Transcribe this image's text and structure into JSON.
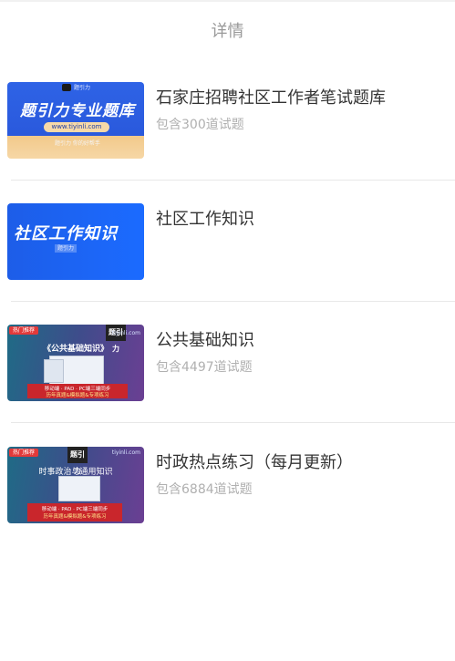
{
  "header": {
    "title": "详情"
  },
  "items": [
    {
      "title": "石家庄招聘社区工作者笔试题库",
      "subtitle": "包含300道试题",
      "thumb": {
        "headline": "题引力专业题库",
        "logo_text": "题引力",
        "url": "www.tiyinli.com",
        "tagline": "题引力 你的好帮手"
      }
    },
    {
      "title": "社区工作知识",
      "subtitle": "",
      "thumb": {
        "headline": "社区工作知识",
        "tag": "题引力"
      }
    },
    {
      "title": "公共基础知识",
      "subtitle": "包含4497道试题",
      "thumb": {
        "badge": "热门推荐",
        "brand": "题引力",
        "url": "tiyinli.com",
        "headline": "《公共基础知识》",
        "banner_line1": "移动端 · PAD · PC端三端同步",
        "banner_line2": "历年真题&模拟题&专项练习"
      }
    },
    {
      "title": "时政热点练习（每月更新）",
      "subtitle": "包含6884道试题",
      "thumb": {
        "badge": "热门推荐",
        "brand": "题引力",
        "url": "tiyinli.com",
        "headline": "时事政治与通用知识",
        "banner_line1": "移动端 · PAD · PC端三端同步",
        "banner_line2": "历年真题&模拟题&专项练习"
      }
    }
  ]
}
